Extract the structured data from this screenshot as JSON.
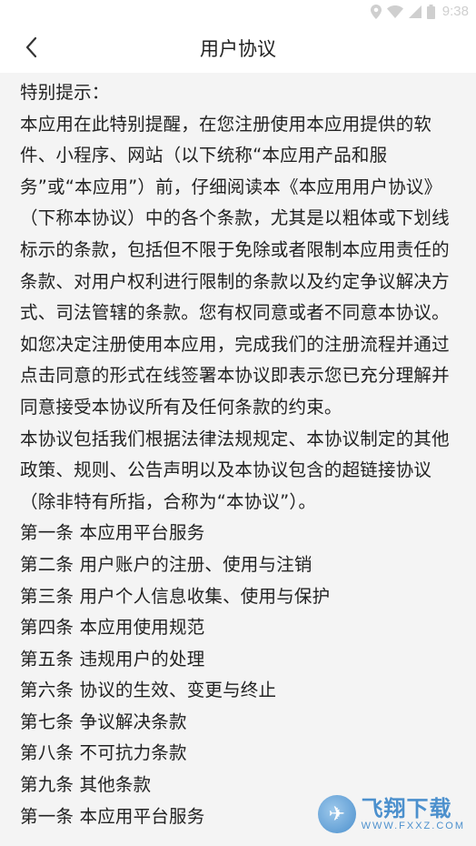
{
  "status_bar": {
    "time": "9:38",
    "icons": [
      "location-icon",
      "wifi-icon",
      "signal-icon",
      "battery-icon"
    ]
  },
  "app_bar": {
    "back_icon": "chevron-left-icon",
    "title": "用户协议"
  },
  "content": {
    "paragraphs": [
      "特别提示：",
      "本应用在此特别提醒，在您注册使用本应用提供的软件、小程序、网站（以下统称“本应用产品和服务”或“本应用”）前，仔细阅读本《本应用用户协议》（下称本协议）中的各个条款，尤其是以粗体或下划线标示的条款，包括但不限于免除或者限制本应用责任的条款、对用户权利进行限制的条款以及约定争议解决方式、司法管辖的条款。您有权同意或者不同意本协议。",
      "如您决定注册使用本应用，完成我们的注册流程并通过点击同意的形式在线签署本协议即表示您已充分理解并同意接受本协议所有及任何条款的约束。",
      "本协议包括我们根据法律法规规定、本协议制定的其他政策、规则、公告声明以及本协议包含的超链接协议（除非特有所指，合称为“本协议”）。",
      "第一条 本应用平台服务",
      "第二条 用户账户的注册、使用与注销",
      "第三条 用户个人信息收集、使用与保护",
      "第四条 本应用使用规范",
      "第五条 违规用户的处理",
      "第六条 协议的生效、变更与终止",
      "第七条 争议解决条款",
      "第八条 不可抗力条款",
      "第九条 其他条款",
      "第一条 本应用平台服务"
    ]
  },
  "watermark": {
    "title": "飞翔下载",
    "url": "WWW.FXXZ.COM"
  },
  "colors": {
    "background": "#f4f4f4",
    "bar": "#ffffff",
    "text": "#222222",
    "watermark": "#2f7fc7"
  }
}
